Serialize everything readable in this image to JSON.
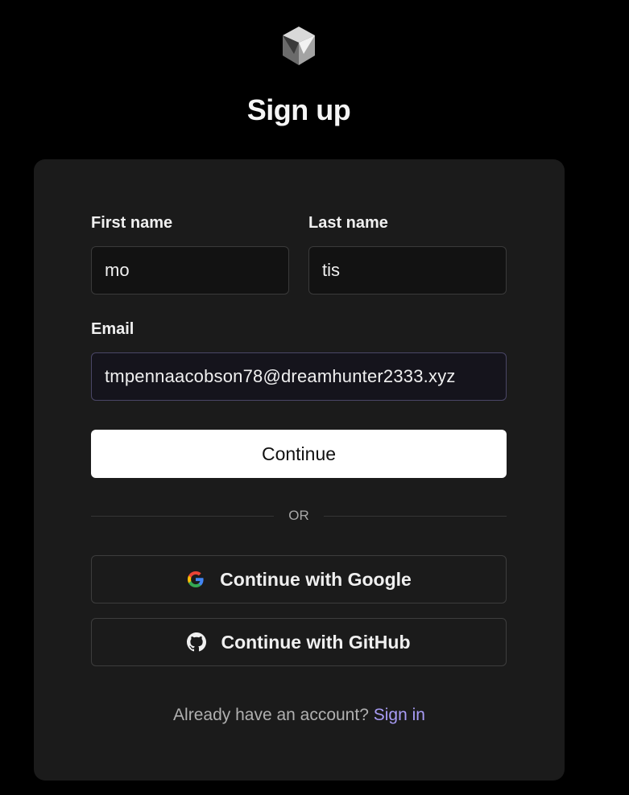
{
  "page": {
    "title": "Sign up",
    "logo_icon": "cube-logo-icon"
  },
  "form": {
    "first_name_label": "First name",
    "first_name_value": "mo",
    "last_name_label": "Last name",
    "last_name_value": "tis",
    "email_label": "Email",
    "email_value": "tmpennaacobson78@dreamhunter2333.xyz",
    "continue_label": "Continue"
  },
  "divider": {
    "text": "OR"
  },
  "oauth": {
    "google_label": "Continue with Google",
    "google_icon": "google-icon",
    "github_label": "Continue with GitHub",
    "github_icon": "github-icon"
  },
  "footer": {
    "prompt": "Already have an account?",
    "signin_label": "Sign in"
  },
  "colors": {
    "background": "#000000",
    "card": "#1b1b1b",
    "accent_link": "#a89cf5",
    "primary_button": "#ffffff"
  }
}
